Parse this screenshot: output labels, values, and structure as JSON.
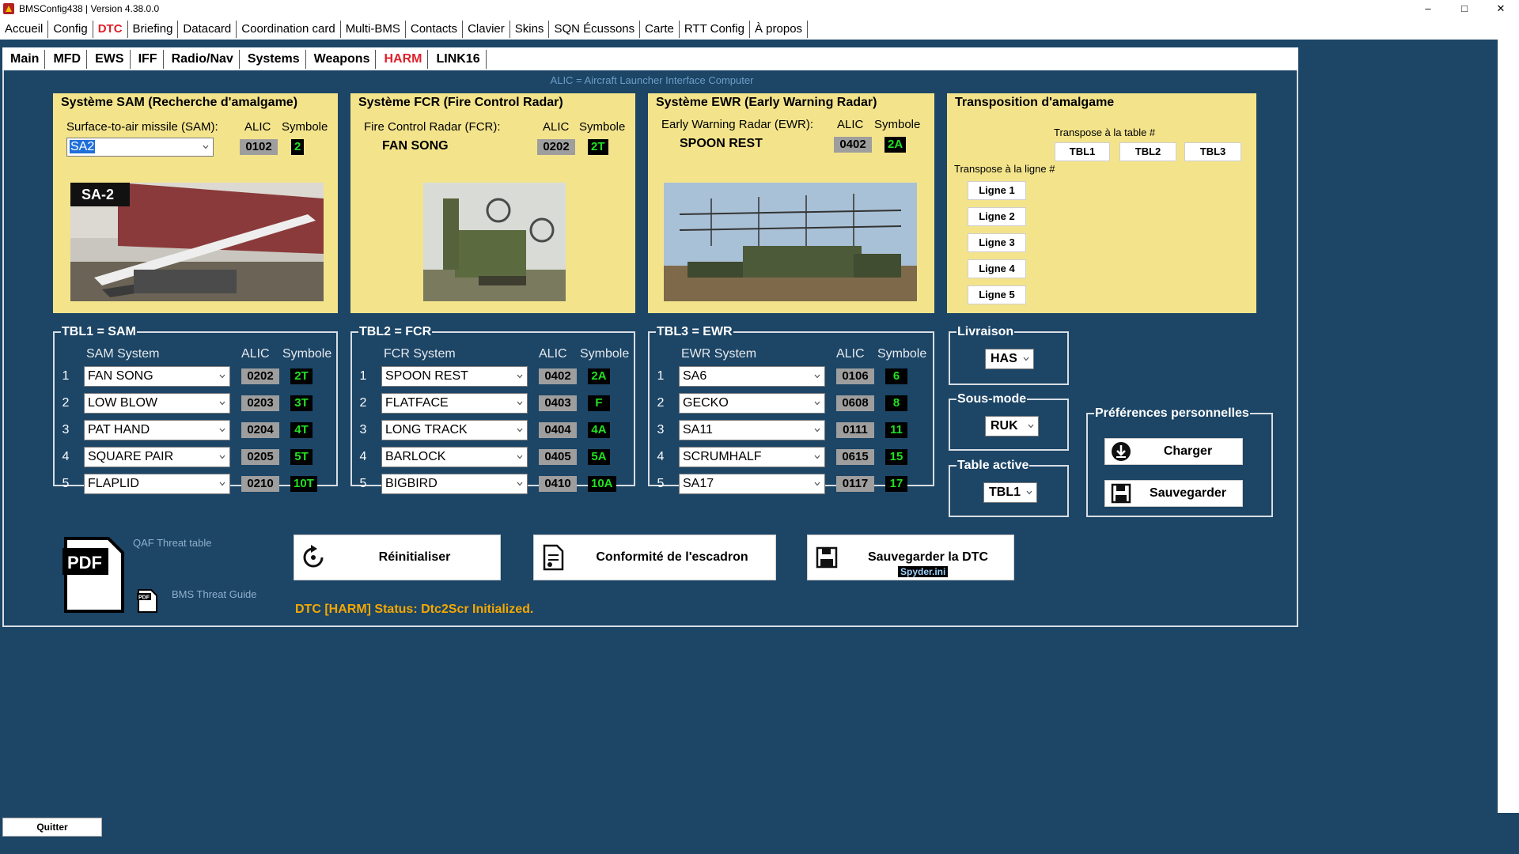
{
  "window": {
    "title": "BMSConfig438 | Version 4.38.0.0",
    "minimize": "–",
    "maximize": "□",
    "close": "✕"
  },
  "mainmenu": [
    "Accueil",
    "Config",
    "DTC",
    "Briefing",
    "Datacard",
    "Coordination card",
    "Multi-BMS",
    "Contacts",
    "Clavier",
    "Skins",
    "SQN Écussons",
    "Carte",
    "RTT Config",
    "À propos"
  ],
  "mainmenu_active": "DTC",
  "subtabs": [
    "Main",
    "MFD",
    "EWS",
    "IFF",
    "Radio/Nav",
    "Systems",
    "Weapons",
    "HARM",
    "LINK16"
  ],
  "subtabs_active": "HARM",
  "caption": "ALIC = Aircraft Launcher Interface Computer",
  "sam_panel": {
    "title": "Système SAM (Recherche d'amalgame)",
    "label": "Surface-to-air missile (SAM):",
    "alic_header": "ALIC",
    "symbol_header": "Symbole",
    "selected": "SA2",
    "alic": "0102",
    "symbol": "2",
    "photo_label": "SA-2"
  },
  "fcr_panel": {
    "title": "Système FCR (Fire Control Radar)",
    "label": "Fire Control Radar (FCR):",
    "alic_header": "ALIC",
    "symbol_header": "Symbole",
    "value": "FAN SONG",
    "alic": "0202",
    "symbol": "2T"
  },
  "ewr_panel": {
    "title": "Système EWR (Early Warning Radar)",
    "label": "Early Warning Radar (EWR):",
    "alic_header": "ALIC",
    "symbol_header": "Symbole",
    "value": "SPOON REST",
    "alic": "0402",
    "symbol": "2A"
  },
  "transpose_panel": {
    "title": "Transposition d'amalgame",
    "table_label": "Transpose à la table #",
    "tables": [
      "TBL1",
      "TBL2",
      "TBL3"
    ],
    "row_label": "Transpose à la ligne #",
    "rows": [
      "Ligne 1",
      "Ligne 2",
      "Ligne 3",
      "Ligne 4",
      "Ligne 5"
    ]
  },
  "tbl1": {
    "title": "TBL1 = SAM",
    "col_system": "SAM System",
    "col_alic": "ALIC",
    "col_symbol": "Symbole",
    "rows": [
      {
        "n": "1",
        "system": "FAN SONG",
        "alic": "0202",
        "symbol": "2T"
      },
      {
        "n": "2",
        "system": "LOW BLOW",
        "alic": "0203",
        "symbol": "3T"
      },
      {
        "n": "3",
        "system": "PAT HAND",
        "alic": "0204",
        "symbol": "4T"
      },
      {
        "n": "4",
        "system": "SQUARE PAIR",
        "alic": "0205",
        "symbol": "5T"
      },
      {
        "n": "5",
        "system": "FLAPLID",
        "alic": "0210",
        "symbol": "10T"
      }
    ]
  },
  "tbl2": {
    "title": "TBL2 = FCR",
    "col_system": "FCR System",
    "col_alic": "ALIC",
    "col_symbol": "Symbole",
    "rows": [
      {
        "n": "1",
        "system": "SPOON REST",
        "alic": "0402",
        "symbol": "2A"
      },
      {
        "n": "2",
        "system": "FLATFACE",
        "alic": "0403",
        "symbol": "F"
      },
      {
        "n": "3",
        "system": "LONG TRACK",
        "alic": "0404",
        "symbol": "4A"
      },
      {
        "n": "4",
        "system": "BARLOCK",
        "alic": "0405",
        "symbol": "5A"
      },
      {
        "n": "5",
        "system": "BIGBIRD",
        "alic": "0410",
        "symbol": "10A"
      }
    ]
  },
  "tbl3": {
    "title": "TBL3 = EWR",
    "col_system": "EWR System",
    "col_alic": "ALIC",
    "col_symbol": "Symbole",
    "rows": [
      {
        "n": "1",
        "system": "SA6",
        "alic": "0106",
        "symbol": "6"
      },
      {
        "n": "2",
        "system": "GECKO",
        "alic": "0608",
        "symbol": "8"
      },
      {
        "n": "3",
        "system": "SA11",
        "alic": "0111",
        "symbol": "11"
      },
      {
        "n": "4",
        "system": "SCRUMHALF",
        "alic": "0615",
        "symbol": "15"
      },
      {
        "n": "5",
        "system": "SA17",
        "alic": "0117",
        "symbol": "17"
      }
    ]
  },
  "livraison": {
    "title": "Livraison",
    "value": "HAS"
  },
  "sousmode": {
    "title": "Sous-mode",
    "value": "RUK"
  },
  "tableactive": {
    "title": "Table active",
    "value": "TBL1"
  },
  "prefs": {
    "title": "Préférences personnelles",
    "load": "Charger",
    "save": "Sauvegarder"
  },
  "links": {
    "pdf_label": "PDF",
    "qaf": "QAF Threat table",
    "bms": "BMS Threat Guide",
    "mini_pdf": "PDF"
  },
  "buttons": {
    "reset": "Réinitialiser",
    "conform": "Conformité de l'escadron",
    "save_dtc": "Sauvegarder la DTC",
    "save_dtc_sub": "Spyder.ini"
  },
  "status": "DTC [HARM] Status: Dtc2Scr Initialized.",
  "quit": "Quitter",
  "colors": {
    "background": "#1c4566",
    "panel": "#f3e48c",
    "active_tab": "#e0202a",
    "symbol_text": "#22e022",
    "status": "#f5a800"
  }
}
